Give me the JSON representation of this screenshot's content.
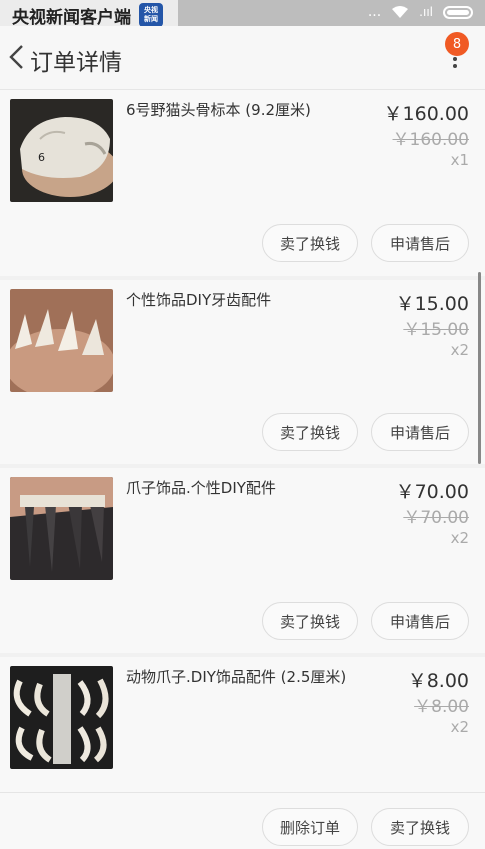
{
  "watermark": {
    "text": "央视新闻客户端",
    "logo_top": "央视",
    "logo_bottom": "新闻"
  },
  "status": {
    "dots": "...",
    "signal": ".ııl"
  },
  "nav": {
    "title": "订单详情",
    "badge": "8"
  },
  "items": [
    {
      "title": "6号野猫头骨标本 (9.2厘米)",
      "price": "￥160.00",
      "orig_price": "￥160.00",
      "qty": "x1",
      "btn_left": "卖了换钱",
      "btn_right": "申请售后"
    },
    {
      "title": "个性饰品DIY牙齿配件",
      "price": "￥15.00",
      "orig_price": "￥15.00",
      "qty": "x2",
      "btn_left": "卖了换钱",
      "btn_right": "申请售后"
    },
    {
      "title": "爪子饰品.个性DIY配件",
      "price": "￥70.00",
      "orig_price": "￥70.00",
      "qty": "x2",
      "btn_left": "卖了换钱",
      "btn_right": "申请售后"
    },
    {
      "title": "动物爪子.DIY饰品配件 (2.5厘米)",
      "price": "￥8.00",
      "orig_price": "￥8.00",
      "qty": "x2"
    }
  ],
  "footer": {
    "delete_label": "删除订单",
    "sell_label": "卖了换钱"
  }
}
